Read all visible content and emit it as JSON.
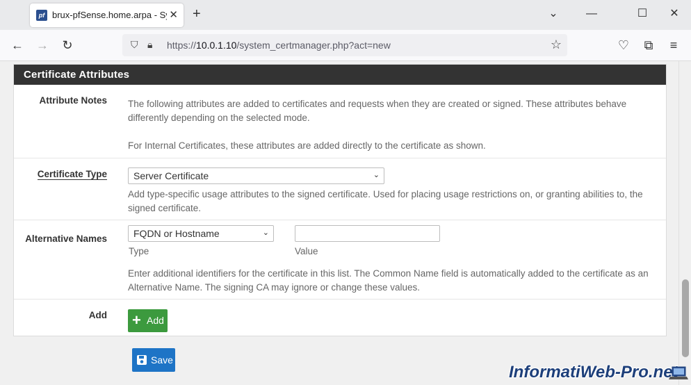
{
  "browser": {
    "tab_title": "brux-pfSense.home.arpa - System",
    "favicon_text": "pf",
    "url_prefix": "https://",
    "url_host": "10.0.1.10",
    "url_path": "/system_certmanager.php?act=new"
  },
  "section": {
    "title": "Certificate Attributes"
  },
  "attribute_notes": {
    "label": "Attribute Notes",
    "line1": "The following attributes are added to certificates and requests when they are created or signed. These attributes behave differently depending on the selected mode.",
    "line2": "For Internal Certificates, these attributes are added directly to the certificate as shown."
  },
  "certificate_type": {
    "label": "Certificate Type",
    "selected": "Server Certificate",
    "help": "Add type-specific usage attributes to the signed certificate. Used for placing usage restrictions on, or granting abilities to, the signed certificate."
  },
  "alternative_names": {
    "label": "Alternative Names",
    "type_selected": "FQDN or Hostname",
    "value": "",
    "type_caption": "Type",
    "value_caption": "Value",
    "help": "Enter additional identifiers for the certificate in this list. The Common Name field is automatically added to the certificate as an Alternative Name. The signing CA may ignore or change these values."
  },
  "add_row": {
    "label": "Add",
    "button_label": "Add"
  },
  "save_button_label": "Save",
  "watermark": "InformatiWeb-Pro.net",
  "colors": {
    "panel_header": "#333333",
    "add_button": "#3c9a3e",
    "save_button": "#1e74c6"
  }
}
